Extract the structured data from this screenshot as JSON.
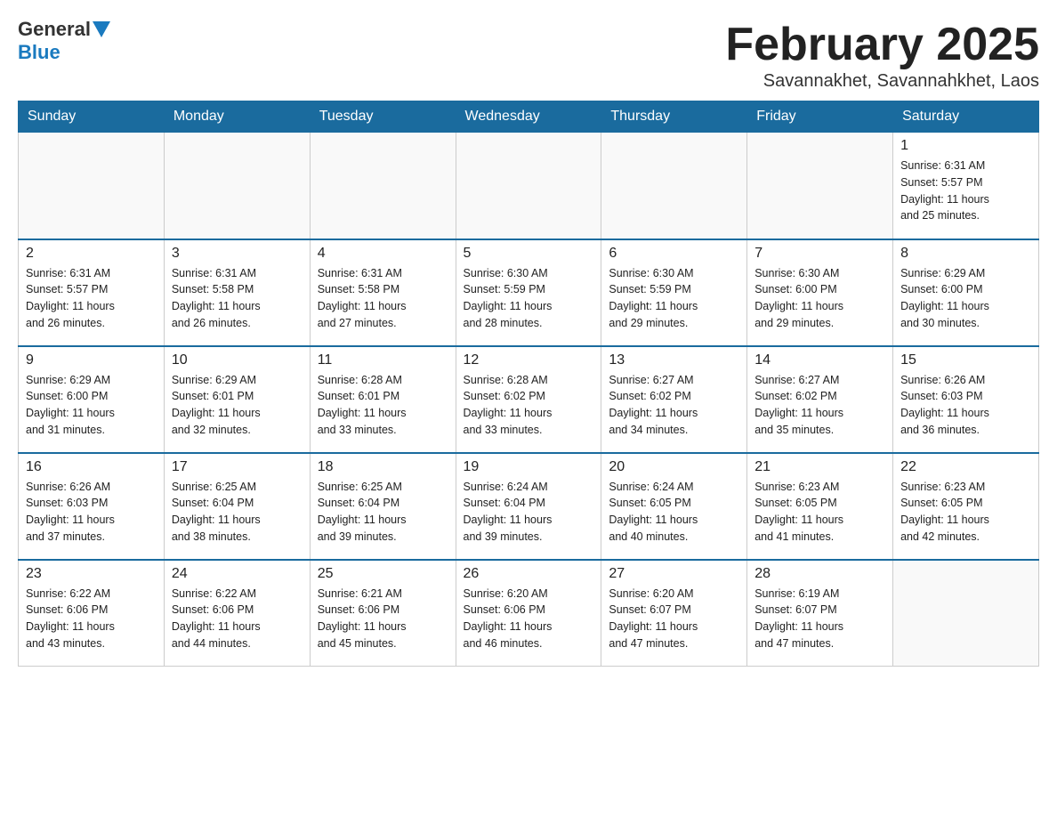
{
  "logo": {
    "general": "General",
    "blue": "Blue"
  },
  "title": "February 2025",
  "location": "Savannakhet, Savannahkhet, Laos",
  "days_of_week": [
    "Sunday",
    "Monday",
    "Tuesday",
    "Wednesday",
    "Thursday",
    "Friday",
    "Saturday"
  ],
  "weeks": [
    [
      {
        "day": "",
        "info": ""
      },
      {
        "day": "",
        "info": ""
      },
      {
        "day": "",
        "info": ""
      },
      {
        "day": "",
        "info": ""
      },
      {
        "day": "",
        "info": ""
      },
      {
        "day": "",
        "info": ""
      },
      {
        "day": "1",
        "info": "Sunrise: 6:31 AM\nSunset: 5:57 PM\nDaylight: 11 hours\nand 25 minutes."
      }
    ],
    [
      {
        "day": "2",
        "info": "Sunrise: 6:31 AM\nSunset: 5:57 PM\nDaylight: 11 hours\nand 26 minutes."
      },
      {
        "day": "3",
        "info": "Sunrise: 6:31 AM\nSunset: 5:58 PM\nDaylight: 11 hours\nand 26 minutes."
      },
      {
        "day": "4",
        "info": "Sunrise: 6:31 AM\nSunset: 5:58 PM\nDaylight: 11 hours\nand 27 minutes."
      },
      {
        "day": "5",
        "info": "Sunrise: 6:30 AM\nSunset: 5:59 PM\nDaylight: 11 hours\nand 28 minutes."
      },
      {
        "day": "6",
        "info": "Sunrise: 6:30 AM\nSunset: 5:59 PM\nDaylight: 11 hours\nand 29 minutes."
      },
      {
        "day": "7",
        "info": "Sunrise: 6:30 AM\nSunset: 6:00 PM\nDaylight: 11 hours\nand 29 minutes."
      },
      {
        "day": "8",
        "info": "Sunrise: 6:29 AM\nSunset: 6:00 PM\nDaylight: 11 hours\nand 30 minutes."
      }
    ],
    [
      {
        "day": "9",
        "info": "Sunrise: 6:29 AM\nSunset: 6:00 PM\nDaylight: 11 hours\nand 31 minutes."
      },
      {
        "day": "10",
        "info": "Sunrise: 6:29 AM\nSunset: 6:01 PM\nDaylight: 11 hours\nand 32 minutes."
      },
      {
        "day": "11",
        "info": "Sunrise: 6:28 AM\nSunset: 6:01 PM\nDaylight: 11 hours\nand 33 minutes."
      },
      {
        "day": "12",
        "info": "Sunrise: 6:28 AM\nSunset: 6:02 PM\nDaylight: 11 hours\nand 33 minutes."
      },
      {
        "day": "13",
        "info": "Sunrise: 6:27 AM\nSunset: 6:02 PM\nDaylight: 11 hours\nand 34 minutes."
      },
      {
        "day": "14",
        "info": "Sunrise: 6:27 AM\nSunset: 6:02 PM\nDaylight: 11 hours\nand 35 minutes."
      },
      {
        "day": "15",
        "info": "Sunrise: 6:26 AM\nSunset: 6:03 PM\nDaylight: 11 hours\nand 36 minutes."
      }
    ],
    [
      {
        "day": "16",
        "info": "Sunrise: 6:26 AM\nSunset: 6:03 PM\nDaylight: 11 hours\nand 37 minutes."
      },
      {
        "day": "17",
        "info": "Sunrise: 6:25 AM\nSunset: 6:04 PM\nDaylight: 11 hours\nand 38 minutes."
      },
      {
        "day": "18",
        "info": "Sunrise: 6:25 AM\nSunset: 6:04 PM\nDaylight: 11 hours\nand 39 minutes."
      },
      {
        "day": "19",
        "info": "Sunrise: 6:24 AM\nSunset: 6:04 PM\nDaylight: 11 hours\nand 39 minutes."
      },
      {
        "day": "20",
        "info": "Sunrise: 6:24 AM\nSunset: 6:05 PM\nDaylight: 11 hours\nand 40 minutes."
      },
      {
        "day": "21",
        "info": "Sunrise: 6:23 AM\nSunset: 6:05 PM\nDaylight: 11 hours\nand 41 minutes."
      },
      {
        "day": "22",
        "info": "Sunrise: 6:23 AM\nSunset: 6:05 PM\nDaylight: 11 hours\nand 42 minutes."
      }
    ],
    [
      {
        "day": "23",
        "info": "Sunrise: 6:22 AM\nSunset: 6:06 PM\nDaylight: 11 hours\nand 43 minutes."
      },
      {
        "day": "24",
        "info": "Sunrise: 6:22 AM\nSunset: 6:06 PM\nDaylight: 11 hours\nand 44 minutes."
      },
      {
        "day": "25",
        "info": "Sunrise: 6:21 AM\nSunset: 6:06 PM\nDaylight: 11 hours\nand 45 minutes."
      },
      {
        "day": "26",
        "info": "Sunrise: 6:20 AM\nSunset: 6:06 PM\nDaylight: 11 hours\nand 46 minutes."
      },
      {
        "day": "27",
        "info": "Sunrise: 6:20 AM\nSunset: 6:07 PM\nDaylight: 11 hours\nand 47 minutes."
      },
      {
        "day": "28",
        "info": "Sunrise: 6:19 AM\nSunset: 6:07 PM\nDaylight: 11 hours\nand 47 minutes."
      },
      {
        "day": "",
        "info": ""
      }
    ]
  ]
}
